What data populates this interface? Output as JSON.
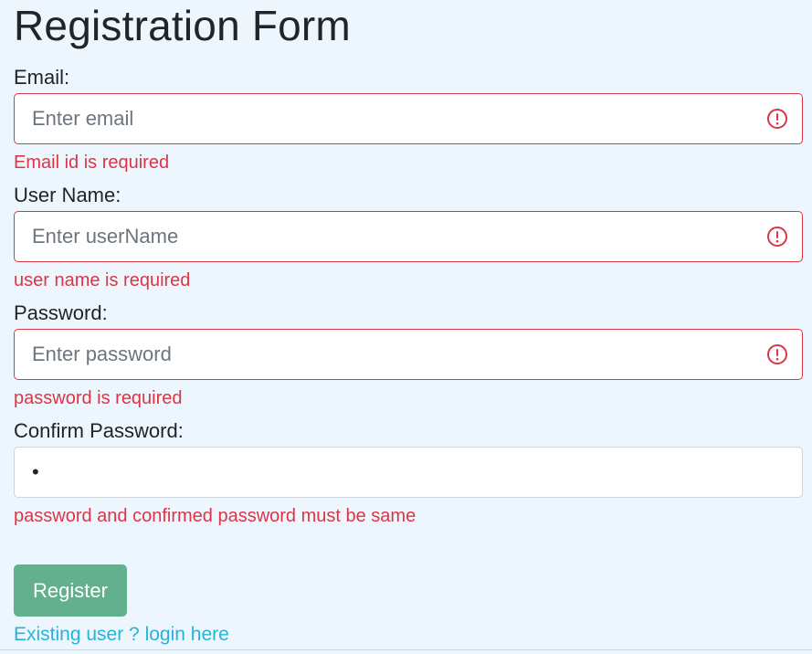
{
  "form": {
    "title": "Registration Form",
    "fields": [
      {
        "label": "Email:",
        "placeholder": "Enter email",
        "value": "",
        "error": "Email id is required"
      },
      {
        "label": "User Name:",
        "placeholder": "Enter userName",
        "value": "",
        "error": "user name is required"
      },
      {
        "label": "Password:",
        "placeholder": "Enter password",
        "value": "",
        "error": "password is required"
      },
      {
        "label": "Confirm Password:",
        "placeholder": "",
        "value": "•",
        "error": "password and confirmed password must be same"
      }
    ],
    "register_label": "Register",
    "login_link": "Existing user ? login here"
  },
  "colors": {
    "background": "#eef6fd",
    "error": "#dc3545",
    "button": "#63b08e",
    "link": "#27b3d8"
  },
  "icons": {
    "field_error": "exclamation-circle-icon"
  }
}
